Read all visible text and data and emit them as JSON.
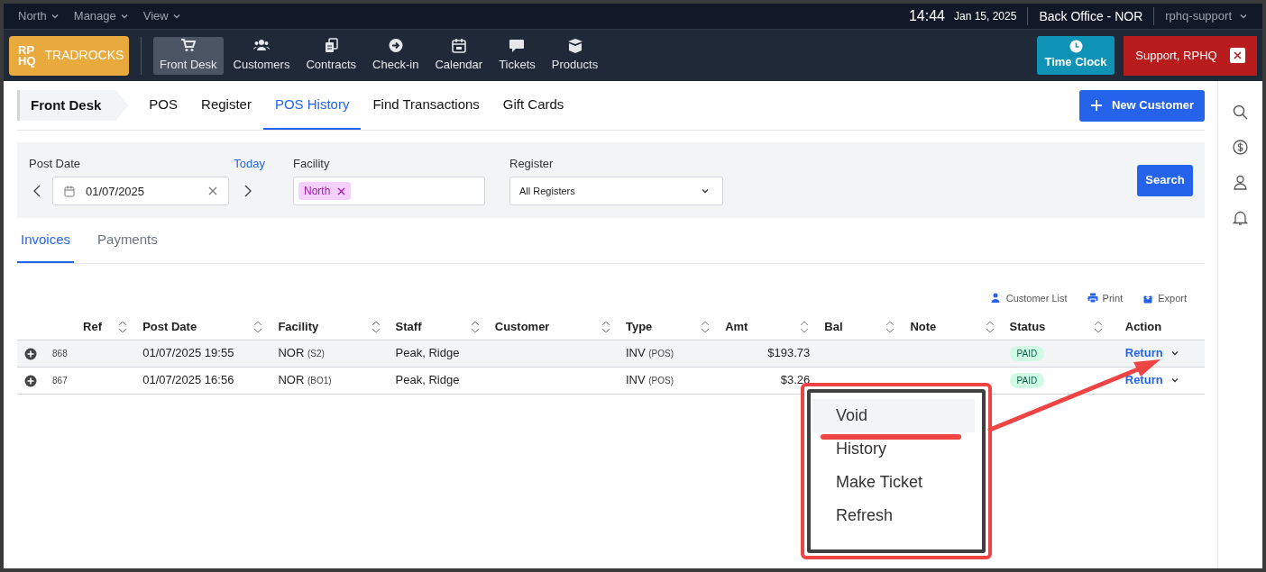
{
  "top_bar": {
    "menus": [
      "North",
      "Manage",
      "View"
    ],
    "time": "14:44",
    "date": "Jan 15, 2025",
    "location": "Back Office - NOR",
    "user": "rphq-support"
  },
  "nav": {
    "logo_mark": [
      "RP",
      "HQ"
    ],
    "brand": "TRADROCKS",
    "items": [
      {
        "label": "Front Desk",
        "selected": true
      },
      {
        "label": "Customers",
        "selected": false
      },
      {
        "label": "Contracts",
        "selected": false
      },
      {
        "label": "Check-in",
        "selected": false
      },
      {
        "label": "Calendar",
        "selected": false
      },
      {
        "label": "Tickets",
        "selected": false
      },
      {
        "label": "Products",
        "selected": false
      }
    ],
    "time_clock": "Time Clock",
    "support": "Support, RPHQ"
  },
  "subnav": {
    "section": "Front Desk",
    "tabs": [
      {
        "label": "POS",
        "selected": false
      },
      {
        "label": "Register",
        "selected": false
      },
      {
        "label": "POS History",
        "selected": true
      },
      {
        "label": "Find Transactions",
        "selected": false
      },
      {
        "label": "Gift Cards",
        "selected": false
      }
    ],
    "new_customer": "New Customer"
  },
  "filters": {
    "post_date_label": "Post Date",
    "today_link": "Today",
    "date_value": "01/07/2025",
    "facility_label": "Facility",
    "facility_tags": [
      "North"
    ],
    "register_label": "Register",
    "register_value": "All Registers",
    "search_button": "Search"
  },
  "tabs": [
    {
      "label": "Invoices",
      "selected": true
    },
    {
      "label": "Payments",
      "selected": false
    }
  ],
  "table_actions": [
    {
      "label": "Customer List"
    },
    {
      "label": "Print"
    },
    {
      "label": "Export"
    }
  ],
  "table": {
    "columns": [
      {
        "label": "Ref",
        "sortable": true
      },
      {
        "label": "Post Date",
        "sortable": true
      },
      {
        "label": "Facility",
        "sortable": true
      },
      {
        "label": "Staff",
        "sortable": true
      },
      {
        "label": "Customer",
        "sortable": true
      },
      {
        "label": "Type",
        "sortable": true
      },
      {
        "label": "Amt",
        "sortable": true
      },
      {
        "label": "Bal",
        "sortable": true
      },
      {
        "label": "Note",
        "sortable": true
      },
      {
        "label": "Status",
        "sortable": true
      },
      {
        "label": "Action",
        "sortable": false
      }
    ],
    "rows": [
      {
        "ref": "868",
        "post_date": "01/07/2025 19:55",
        "facility": "NOR",
        "facility_code": "(S2)",
        "staff": "Peak, Ridge",
        "type": "INV",
        "type_code": "(POS)",
        "amt": "$193.73",
        "status": "PAID",
        "action": "Return",
        "highlighted": true
      },
      {
        "ref": "867",
        "post_date": "01/07/2025 16:56",
        "facility": "NOR",
        "facility_code": "(BO1)",
        "staff": "Peak, Ridge",
        "type": "INV",
        "type_code": "(POS)",
        "amt": "$3.26",
        "status": "PAID",
        "action": "Return",
        "highlighted": false
      }
    ]
  },
  "action_menu": {
    "items": [
      {
        "label": "Void",
        "highlighted": true
      },
      {
        "label": "History",
        "highlighted": false
      },
      {
        "label": "Make Ticket",
        "highlighted": false
      },
      {
        "label": "Refresh",
        "highlighted": false
      }
    ]
  }
}
